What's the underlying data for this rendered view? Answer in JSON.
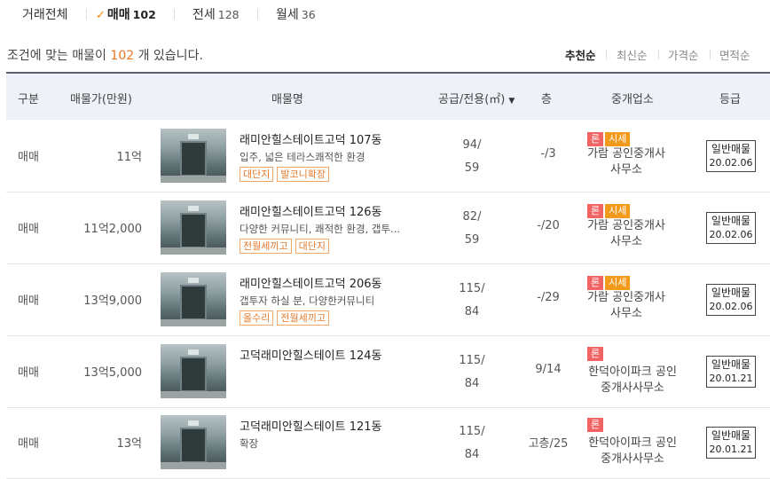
{
  "tabs": [
    {
      "label": "거래전체",
      "count": ""
    },
    {
      "label": "매매",
      "count": "102",
      "active": true
    },
    {
      "label": "전세",
      "count": "128"
    },
    {
      "label": "월세",
      "count": "36"
    }
  ],
  "summary": {
    "prefix": "조건에 맞는 매물이",
    "count": "102",
    "suffix": "개 있습니다."
  },
  "sort": [
    "추천순",
    "최신순",
    "가격순",
    "면적순"
  ],
  "table_headers": {
    "type": "구분",
    "price": "매물가(만원)",
    "name": "매물명",
    "area": "공급/전용(㎡)",
    "floor": "층",
    "agent": "중개업소",
    "grade": "등급"
  },
  "rows": [
    {
      "type": "매매",
      "price": "11억",
      "title": "래미안힐스테이트고덕 107동",
      "desc": "입주, 넓은 테라스쾌적한 환경",
      "tags": [
        "대단지",
        "발코니확장"
      ],
      "supply": "94/",
      "exclusive": "59",
      "floor": "-/3",
      "badges": [
        "론",
        "시세"
      ],
      "agent_line1": "가람 공인중개사",
      "agent_line2": "사무소",
      "grade": "일반매물",
      "grade_date": "20.02.06"
    },
    {
      "type": "매매",
      "price": "11억2,000",
      "title": "래미안힐스테이트고덕 126동",
      "desc": "다양한 커뮤니티, 쾌적한 환경, 갭투...",
      "tags": [
        "전월세끼고",
        "대단지"
      ],
      "supply": "82/",
      "exclusive": "59",
      "floor": "-/20",
      "badges": [
        "론",
        "시세"
      ],
      "agent_line1": "가람 공인중개사",
      "agent_line2": "사무소",
      "grade": "일반매물",
      "grade_date": "20.02.06"
    },
    {
      "type": "매매",
      "price": "13억9,000",
      "title": "래미안힐스테이트고덕 206동",
      "desc": "갭투자 하실 분, 다양한커뮤니티",
      "tags": [
        "올수리",
        "전월세끼고"
      ],
      "supply": "115/",
      "exclusive": "84",
      "floor": "-/29",
      "badges": [
        "론",
        "시세"
      ],
      "agent_line1": "가람 공인중개사",
      "agent_line2": "사무소",
      "grade": "일반매물",
      "grade_date": "20.02.06"
    },
    {
      "type": "매매",
      "price": "13억5,000",
      "title": "고덕래미안힐스테이트 124동",
      "desc": "",
      "tags": [],
      "supply": "115/",
      "exclusive": "84",
      "floor": "9/14",
      "badges": [
        "론"
      ],
      "agent_line1": "한덕아이파크 공인",
      "agent_line2": "중개사사무소",
      "grade": "일반매물",
      "grade_date": "20.01.21"
    },
    {
      "type": "매매",
      "price": "13억",
      "title": "고덕래미안힐스테이트 121동",
      "desc": "확장",
      "tags": [],
      "supply": "115/",
      "exclusive": "84",
      "floor": "고층/25",
      "badges": [
        "론"
      ],
      "agent_line1": "한덕아이파크 공인",
      "agent_line2": "중개사사무소",
      "grade": "일반매물",
      "grade_date": "20.01.21"
    }
  ]
}
